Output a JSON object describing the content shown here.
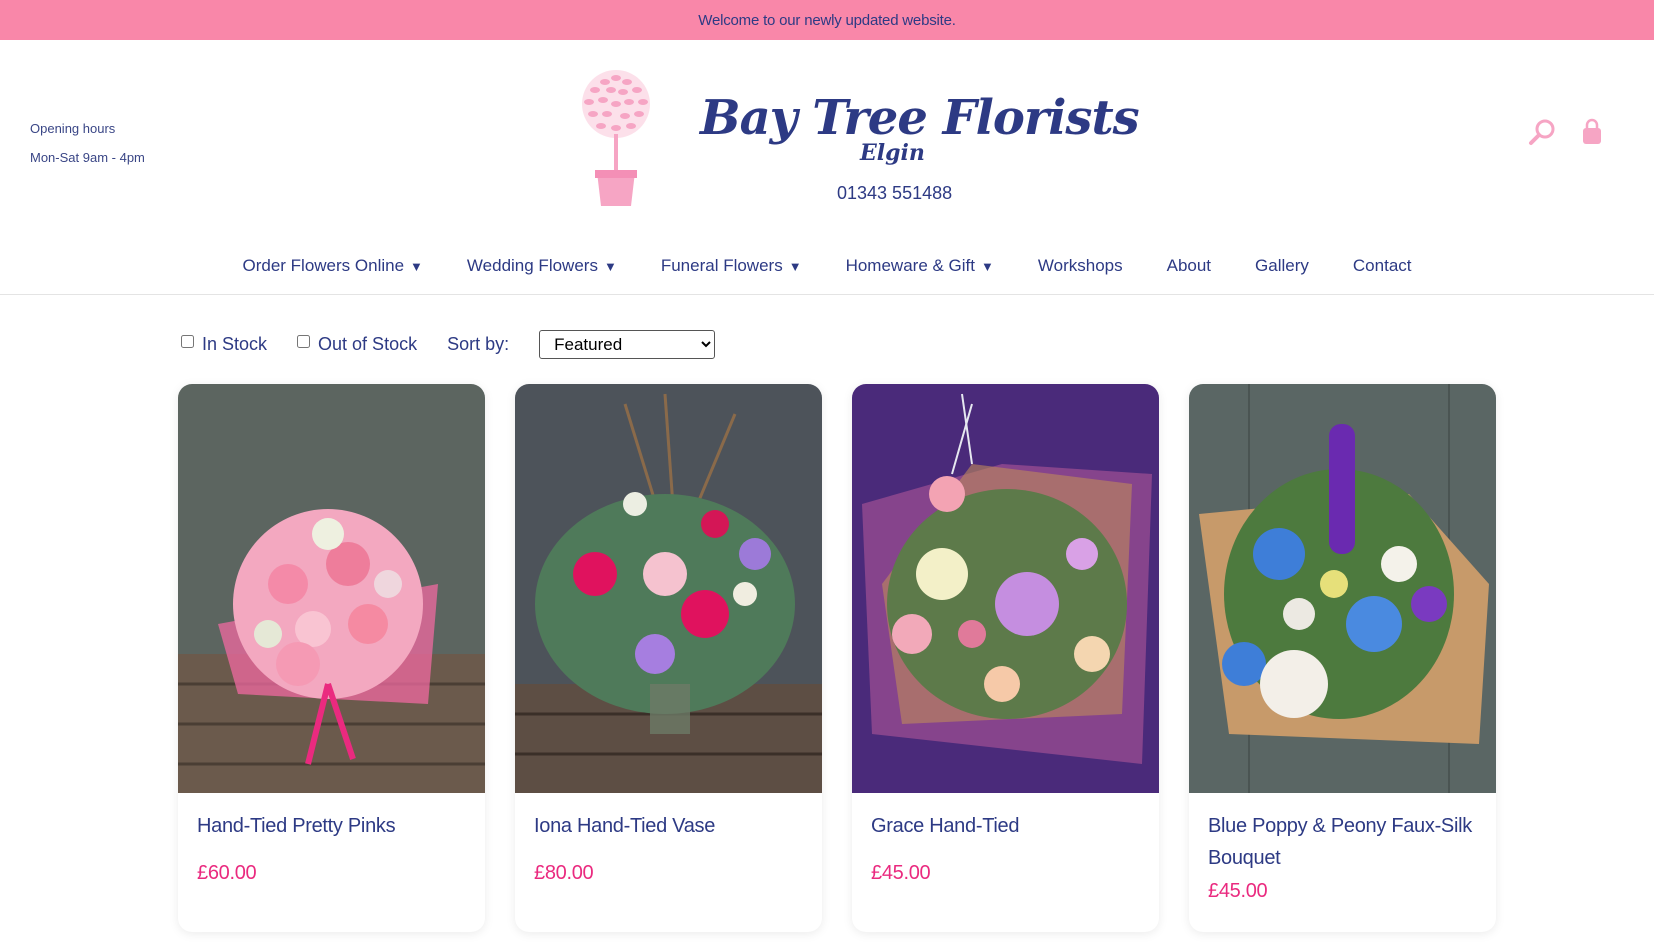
{
  "banner": {
    "text": "Welcome to our newly updated website."
  },
  "hours": {
    "label": "Opening hours",
    "times": "Mon-Sat 9am - 4pm"
  },
  "logo": {
    "title": "Bay Tree Florists",
    "subtitle": "Elgin",
    "phone": "01343 551488"
  },
  "header_icons": [
    "search-icon",
    "bag-icon"
  ],
  "nav": {
    "items": [
      {
        "label": "Order Flowers Online",
        "caret": "▼"
      },
      {
        "label": "Wedding Flowers",
        "caret": "▼"
      },
      {
        "label": "Funeral Flowers",
        "caret": "▼"
      },
      {
        "label": "Homeware & Gift",
        "caret": "▼"
      },
      {
        "label": "Workshops",
        "caret": ""
      },
      {
        "label": "About",
        "caret": ""
      },
      {
        "label": "Gallery",
        "caret": ""
      },
      {
        "label": "Contact",
        "caret": ""
      }
    ]
  },
  "filters": {
    "in_stock": "In Stock",
    "out_of_stock": "Out of Stock",
    "sort_label": "Sort by:",
    "sort_value": "Featured"
  },
  "products": [
    {
      "title": "Hand-Tied Pretty Pinks",
      "price": "£60.00",
      "bg": "#5c6560",
      "accent": "#f06aa0"
    },
    {
      "title": "Iona Hand-Tied Vase",
      "price": "£80.00",
      "bg": "#4d535a",
      "accent": "#e0125e"
    },
    {
      "title": "Grace Hand-Tied",
      "price": "£45.00",
      "bg": "#4a2a7a",
      "accent": "#c58ee0"
    },
    {
      "title": "Blue Poppy & Peony Faux-Silk Bouquet",
      "price": "£45.00",
      "bg": "#5a6664",
      "accent": "#3e7ed8"
    }
  ],
  "colors": {
    "banner": "#f987a9",
    "navy": "#2d3a84",
    "price": "#ea2a7f",
    "logo_pink": "#f6a5c4"
  }
}
